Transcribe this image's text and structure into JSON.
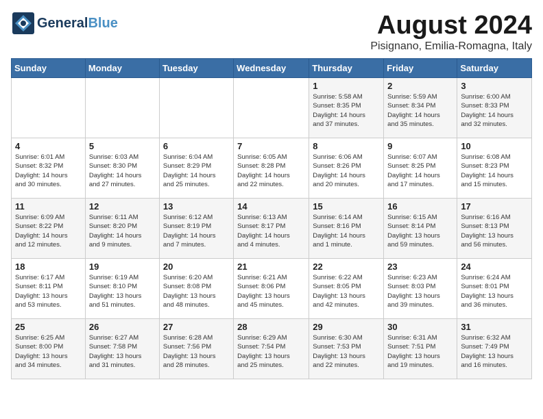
{
  "logo": {
    "line1a": "General",
    "line1b": "Blue",
    "tagline": ""
  },
  "header": {
    "month_year": "August 2024",
    "location": "Pisignano, Emilia-Romagna, Italy"
  },
  "weekdays": [
    "Sunday",
    "Monday",
    "Tuesday",
    "Wednesday",
    "Thursday",
    "Friday",
    "Saturday"
  ],
  "weeks": [
    [
      {
        "day": "",
        "info": ""
      },
      {
        "day": "",
        "info": ""
      },
      {
        "day": "",
        "info": ""
      },
      {
        "day": "",
        "info": ""
      },
      {
        "day": "1",
        "info": "Sunrise: 5:58 AM\nSunset: 8:35 PM\nDaylight: 14 hours\nand 37 minutes."
      },
      {
        "day": "2",
        "info": "Sunrise: 5:59 AM\nSunset: 8:34 PM\nDaylight: 14 hours\nand 35 minutes."
      },
      {
        "day": "3",
        "info": "Sunrise: 6:00 AM\nSunset: 8:33 PM\nDaylight: 14 hours\nand 32 minutes."
      }
    ],
    [
      {
        "day": "4",
        "info": "Sunrise: 6:01 AM\nSunset: 8:32 PM\nDaylight: 14 hours\nand 30 minutes."
      },
      {
        "day": "5",
        "info": "Sunrise: 6:03 AM\nSunset: 8:30 PM\nDaylight: 14 hours\nand 27 minutes."
      },
      {
        "day": "6",
        "info": "Sunrise: 6:04 AM\nSunset: 8:29 PM\nDaylight: 14 hours\nand 25 minutes."
      },
      {
        "day": "7",
        "info": "Sunrise: 6:05 AM\nSunset: 8:28 PM\nDaylight: 14 hours\nand 22 minutes."
      },
      {
        "day": "8",
        "info": "Sunrise: 6:06 AM\nSunset: 8:26 PM\nDaylight: 14 hours\nand 20 minutes."
      },
      {
        "day": "9",
        "info": "Sunrise: 6:07 AM\nSunset: 8:25 PM\nDaylight: 14 hours\nand 17 minutes."
      },
      {
        "day": "10",
        "info": "Sunrise: 6:08 AM\nSunset: 8:23 PM\nDaylight: 14 hours\nand 15 minutes."
      }
    ],
    [
      {
        "day": "11",
        "info": "Sunrise: 6:09 AM\nSunset: 8:22 PM\nDaylight: 14 hours\nand 12 minutes."
      },
      {
        "day": "12",
        "info": "Sunrise: 6:11 AM\nSunset: 8:20 PM\nDaylight: 14 hours\nand 9 minutes."
      },
      {
        "day": "13",
        "info": "Sunrise: 6:12 AM\nSunset: 8:19 PM\nDaylight: 14 hours\nand 7 minutes."
      },
      {
        "day": "14",
        "info": "Sunrise: 6:13 AM\nSunset: 8:17 PM\nDaylight: 14 hours\nand 4 minutes."
      },
      {
        "day": "15",
        "info": "Sunrise: 6:14 AM\nSunset: 8:16 PM\nDaylight: 14 hours\nand 1 minute."
      },
      {
        "day": "16",
        "info": "Sunrise: 6:15 AM\nSunset: 8:14 PM\nDaylight: 13 hours\nand 59 minutes."
      },
      {
        "day": "17",
        "info": "Sunrise: 6:16 AM\nSunset: 8:13 PM\nDaylight: 13 hours\nand 56 minutes."
      }
    ],
    [
      {
        "day": "18",
        "info": "Sunrise: 6:17 AM\nSunset: 8:11 PM\nDaylight: 13 hours\nand 53 minutes."
      },
      {
        "day": "19",
        "info": "Sunrise: 6:19 AM\nSunset: 8:10 PM\nDaylight: 13 hours\nand 51 minutes."
      },
      {
        "day": "20",
        "info": "Sunrise: 6:20 AM\nSunset: 8:08 PM\nDaylight: 13 hours\nand 48 minutes."
      },
      {
        "day": "21",
        "info": "Sunrise: 6:21 AM\nSunset: 8:06 PM\nDaylight: 13 hours\nand 45 minutes."
      },
      {
        "day": "22",
        "info": "Sunrise: 6:22 AM\nSunset: 8:05 PM\nDaylight: 13 hours\nand 42 minutes."
      },
      {
        "day": "23",
        "info": "Sunrise: 6:23 AM\nSunset: 8:03 PM\nDaylight: 13 hours\nand 39 minutes."
      },
      {
        "day": "24",
        "info": "Sunrise: 6:24 AM\nSunset: 8:01 PM\nDaylight: 13 hours\nand 36 minutes."
      }
    ],
    [
      {
        "day": "25",
        "info": "Sunrise: 6:25 AM\nSunset: 8:00 PM\nDaylight: 13 hours\nand 34 minutes."
      },
      {
        "day": "26",
        "info": "Sunrise: 6:27 AM\nSunset: 7:58 PM\nDaylight: 13 hours\nand 31 minutes."
      },
      {
        "day": "27",
        "info": "Sunrise: 6:28 AM\nSunset: 7:56 PM\nDaylight: 13 hours\nand 28 minutes."
      },
      {
        "day": "28",
        "info": "Sunrise: 6:29 AM\nSunset: 7:54 PM\nDaylight: 13 hours\nand 25 minutes."
      },
      {
        "day": "29",
        "info": "Sunrise: 6:30 AM\nSunset: 7:53 PM\nDaylight: 13 hours\nand 22 minutes."
      },
      {
        "day": "30",
        "info": "Sunrise: 6:31 AM\nSunset: 7:51 PM\nDaylight: 13 hours\nand 19 minutes."
      },
      {
        "day": "31",
        "info": "Sunrise: 6:32 AM\nSunset: 7:49 PM\nDaylight: 13 hours\nand 16 minutes."
      }
    ]
  ]
}
